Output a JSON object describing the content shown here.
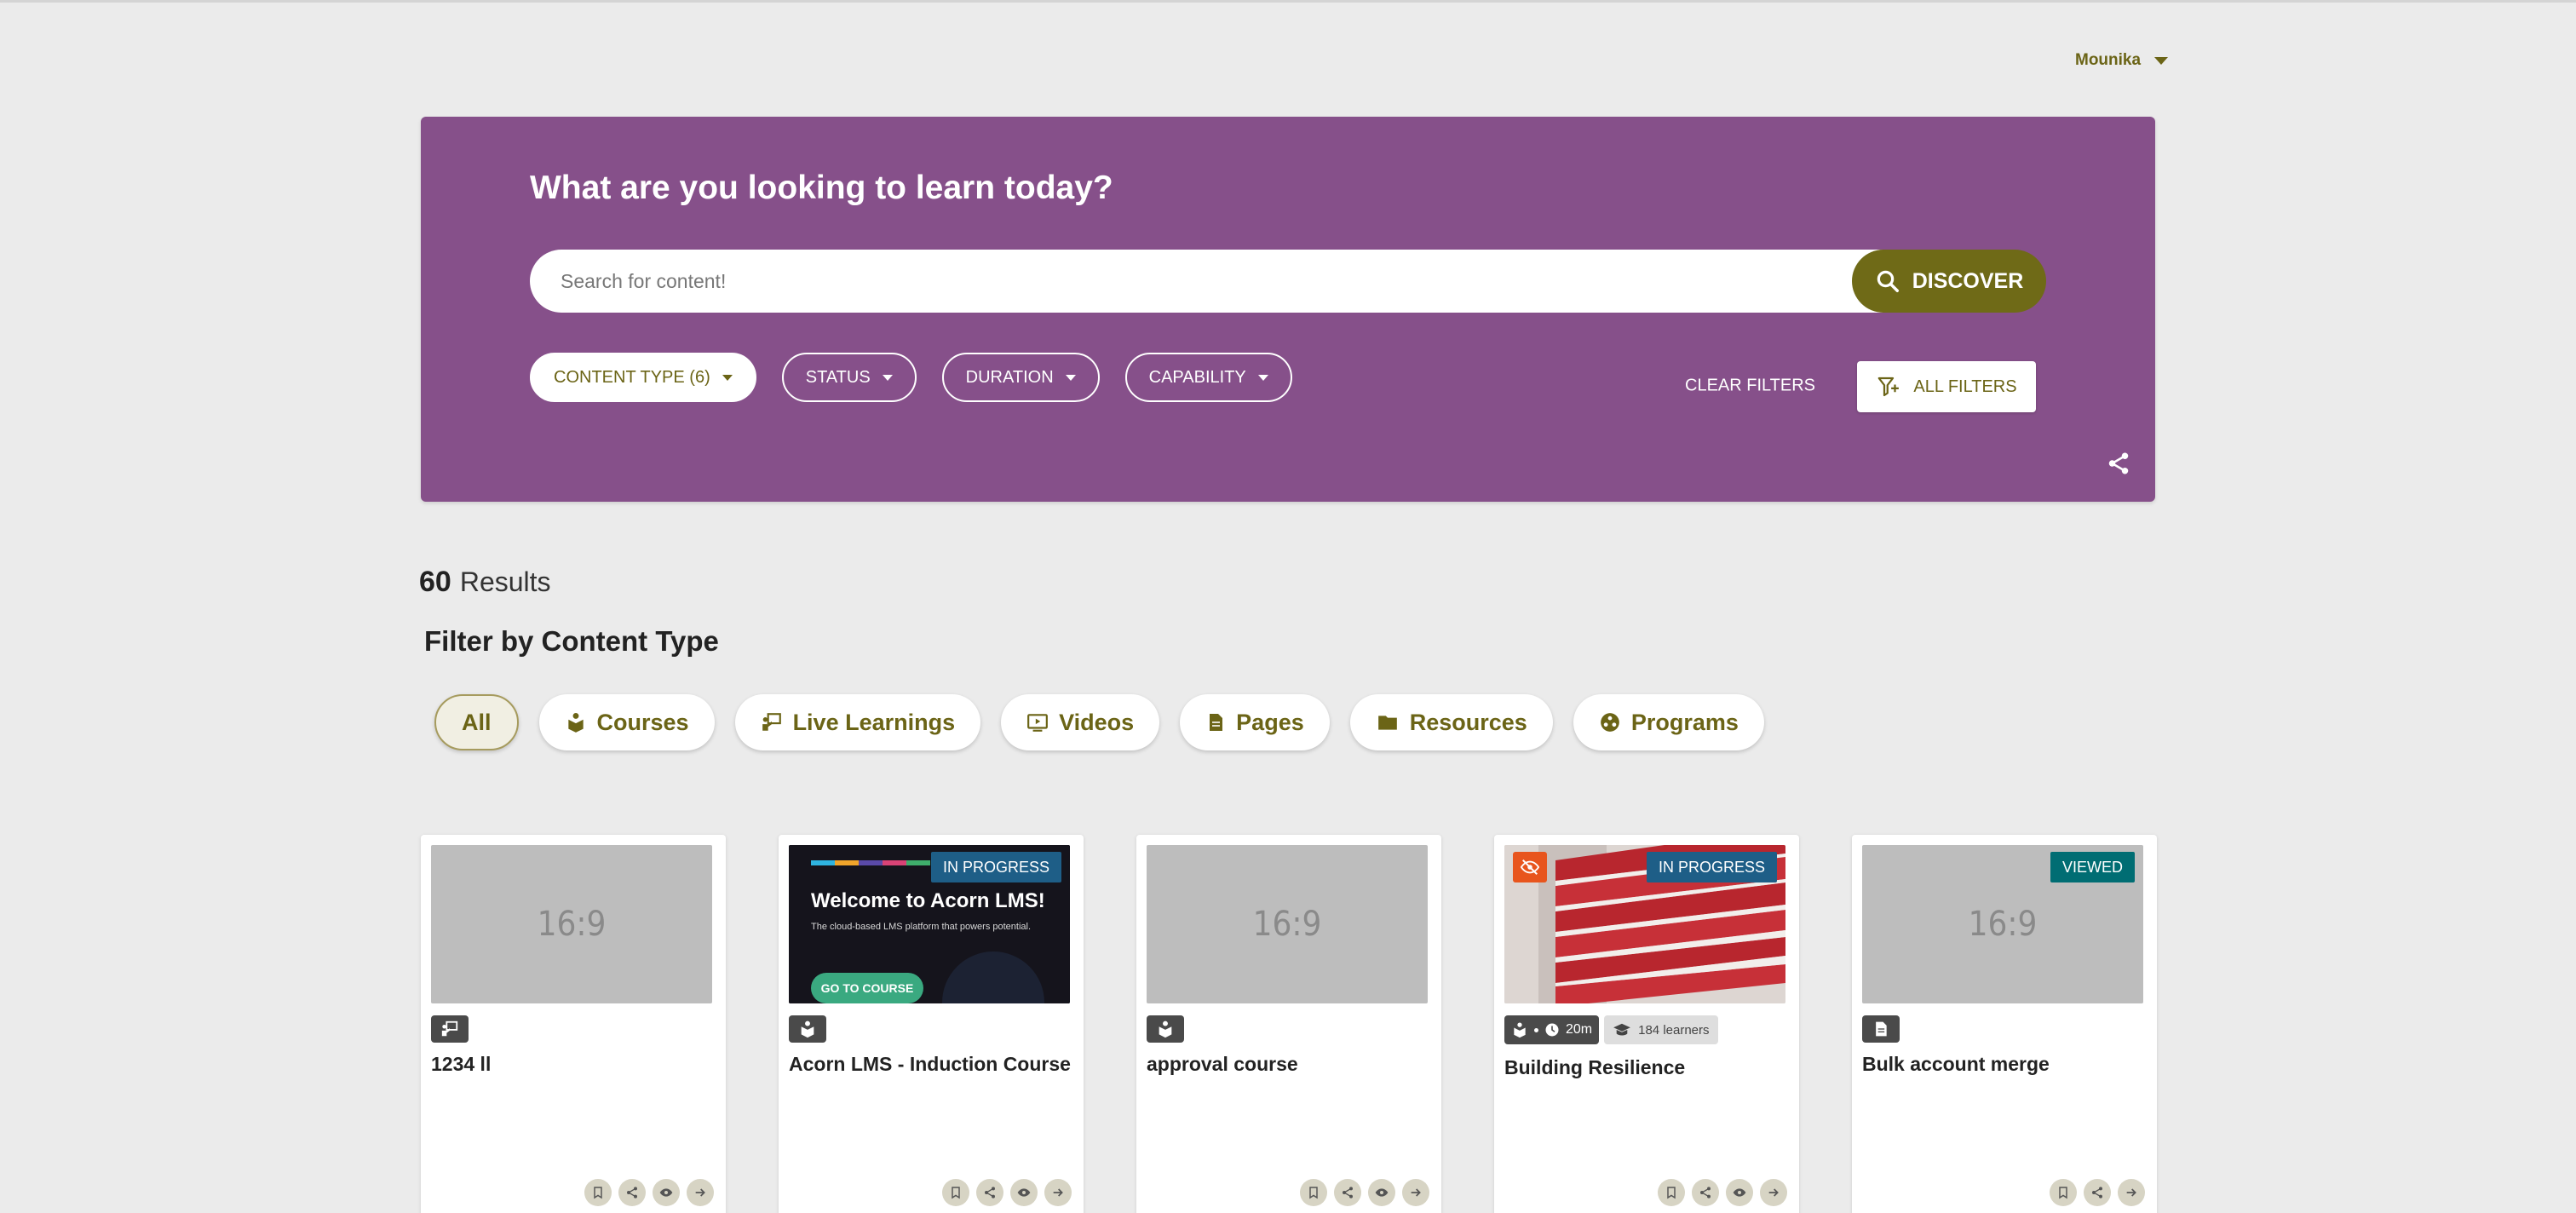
{
  "user": {
    "name": "Mounika"
  },
  "hero": {
    "title": "What are you looking to learn today?",
    "search_placeholder": "Search for content!",
    "discover_label": "DISCOVER",
    "filters": [
      {
        "label": "CONTENT TYPE (6)",
        "active": true
      },
      {
        "label": "STATUS",
        "active": false
      },
      {
        "label": "DURATION",
        "active": false
      },
      {
        "label": "CAPABILITY",
        "active": false
      }
    ],
    "clear_filters_label": "CLEAR FILTERS",
    "all_filters_label": "ALL FILTERS"
  },
  "results": {
    "count": "60",
    "label": "Results"
  },
  "filter_by": {
    "title": "Filter by Content Type",
    "types": [
      {
        "label": "All",
        "icon": "none",
        "active": true
      },
      {
        "label": "Courses",
        "icon": "course-icon"
      },
      {
        "label": "Live Learnings",
        "icon": "live-learning-icon"
      },
      {
        "label": "Videos",
        "icon": "video-icon"
      },
      {
        "label": "Pages",
        "icon": "page-icon"
      },
      {
        "label": "Resources",
        "icon": "folder-icon"
      },
      {
        "label": "Programs",
        "icon": "program-icon"
      }
    ]
  },
  "cards": [
    {
      "title": "1234 ll",
      "type_icon": "live-learning-icon",
      "placeholder": "16:9"
    },
    {
      "title": "Acorn LMS - Induction Course",
      "type_icon": "course-icon",
      "status": "IN PROGRESS",
      "thumb_heading": "Welcome to Acorn LMS!",
      "thumb_sub": "The cloud-based LMS platform that powers potential.",
      "thumb_button": "GO TO COURSE"
    },
    {
      "title": "approval course",
      "type_icon": "course-icon",
      "placeholder": "16:9"
    },
    {
      "title": "Building Resilience",
      "type_icon": "course-icon",
      "status": "IN PROGRESS",
      "duration": "20m",
      "learners": "184 learners"
    },
    {
      "title": "Bulk account merge",
      "type_icon": "page-icon",
      "status": "VIEWED",
      "placeholder": "16:9"
    }
  ],
  "colors": {
    "brand_purple": "#86508a",
    "brand_olive": "#6f6a17",
    "in_progress": "#1e5e87",
    "viewed": "#006d73",
    "hidden": "#e8551d"
  }
}
